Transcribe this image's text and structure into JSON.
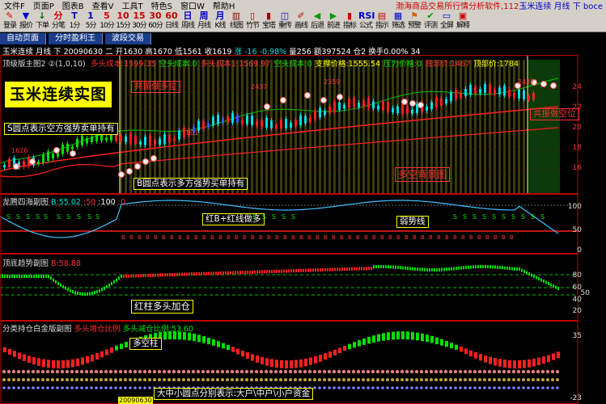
{
  "menu": [
    "文件F",
    "页面P",
    "图表B",
    "查看V",
    "工具T",
    "特色S",
    "窗口W",
    "帮助H"
  ],
  "window_title": "渤海商品交易所行情分析软件,112",
  "window_symbol": "玉米连续 月线 下 boce",
  "toolbar": [
    {
      "glyph": "✎",
      "label": "登录"
    },
    {
      "glyph": "▼",
      "label": "报价"
    },
    {
      "glyph": "↓",
      "label": "下单"
    },
    {
      "glyph": "分",
      "label": "分笔"
    },
    {
      "glyph": "T",
      "label": "1分"
    },
    {
      "glyph": "1",
      "label": "5分"
    },
    {
      "glyph": "5",
      "label": "10分"
    },
    {
      "glyph": "10",
      "label": "15分"
    },
    {
      "glyph": "15",
      "label": "30分"
    },
    {
      "glyph": "30",
      "label": "60分"
    },
    {
      "glyph": "60",
      "label": "日线"
    },
    {
      "glyph": "日",
      "label": "周线"
    },
    {
      "glyph": "周",
      "label": "月线"
    },
    {
      "glyph": "月",
      "label": "K线"
    },
    {
      "glyph": "▥",
      "label": "线图"
    },
    {
      "glyph": "▯",
      "label": "竹节"
    },
    {
      "glyph": "▮",
      "label": "宝塔"
    },
    {
      "glyph": "◫",
      "label": "重传"
    },
    {
      "glyph": "✐",
      "label": "画线"
    },
    {
      "glyph": "◀",
      "label": "后退"
    },
    {
      "glyph": "▶",
      "label": "前进"
    },
    {
      "glyph": "▮",
      "label": "指标"
    },
    {
      "glyph": "RSI",
      "label": "公式"
    },
    {
      "glyph": "▤",
      "label": "指示"
    },
    {
      "glyph": "▦",
      "label": "筛选"
    },
    {
      "glyph": "⚑",
      "label": "预警"
    },
    {
      "glyph": "✔",
      "label": "评测"
    },
    {
      "glyph": "▭",
      "label": "全屏"
    },
    {
      "glyph": "▣",
      "label": "解释"
    }
  ],
  "tabs": [
    "自动页面",
    "分时盈利王",
    "波段交易"
  ],
  "status": {
    "symbol": "玉米连续",
    "period": "月线",
    "dir": "下",
    "date": "20090630",
    "open": "开1630",
    "high": "高1670",
    "low": "低1561",
    "close": "收1619",
    "chg": "涨 -16",
    "pct": "-0.98%",
    "vol": "量256",
    "amt": "额397524",
    "pos": "仓2",
    "turn": "换手0.00%",
    "n": "34"
  },
  "main_panel": {
    "header": "顶级版主图2 ②(1,0,10)",
    "items": [
      {
        "text": "多头成本:1599.35",
        "color": "#ff3030"
      },
      {
        "text": "空头成本:0",
        "color": "#00e000"
      },
      {
        "text": "多头成本1:1569.97",
        "color": "#ff3030"
      },
      {
        "text": "空头成本:0",
        "color": "#00e000"
      },
      {
        "text": "支撑价格:1555.54",
        "color": "#ffff00"
      },
      {
        "text": "压力价格:0",
        "color": "#00e000"
      },
      {
        "text": "底部价:1467",
        "color": "#ff3030"
      },
      {
        "text": "顶部价:1784",
        "color": "#ffff00"
      }
    ],
    "big_title": "玉米连续实图",
    "notes": {
      "resonance_long": "共振做多位",
      "resonance_short": "共振做空位",
      "s_dot": "S圆点表示空方强势卖单持有",
      "b_dot": "B圆点表示多方强势买单持有",
      "bg": "多空背景图"
    },
    "axis": [
      "24",
      "22",
      "20",
      "18",
      "16"
    ],
    "peaks": [
      "2437",
      "2359",
      "1801",
      "1626",
      "2437"
    ]
  },
  "sub1": {
    "header": "龙腾四海副图",
    "val": "B:55.02",
    "val2": ":50",
    "val3": ":100",
    "val4": ":0",
    "note1": "红B+红线做多",
    "note2": "弱势线",
    "axis": [
      "100",
      "50",
      "0"
    ],
    "s_label": "S"
  },
  "sub2": {
    "header": "顶底趋势副图",
    "val": "B:58.88",
    "note": "红柱多头加仓",
    "axis": [
      "80",
      "60",
      "50",
      "40",
      "20"
    ]
  },
  "sub3": {
    "header": "分类持仓白金版副图",
    "val1": "多头增仓比例",
    "val2": "多头减仓比例:53.60",
    "note1": "多空柱",
    "note2": "大中小圆点分别表示:大户\\中户\\小户资金",
    "axis": [
      "35",
      "-23"
    ]
  },
  "bottom_date": "20090630"
}
